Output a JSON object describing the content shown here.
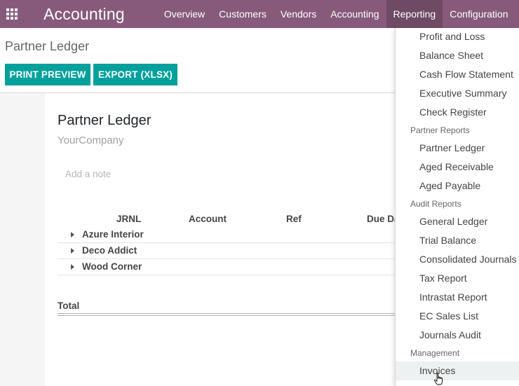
{
  "navbar": {
    "apps_icon": "grid-icon",
    "app_title": "Accounting",
    "menu": [
      "Overview",
      "Customers",
      "Vendors",
      "Accounting",
      "Reporting",
      "Configuration"
    ],
    "active_menu": "Reporting"
  },
  "control_panel": {
    "breadcrumb": "Partner Ledger",
    "print_preview": "PRINT PREVIEW",
    "export_xlsx": "EXPORT (XLSX)"
  },
  "report": {
    "title": "Partner Ledger",
    "company": "YourCompany",
    "note_placeholder": "Add a note",
    "columns": [
      "JRNL",
      "Account",
      "Ref",
      "Due Da"
    ],
    "rows": [
      "Azure Interior",
      "Deco Addict",
      "Wood Corner"
    ],
    "total_label": "Total"
  },
  "dropdown": {
    "top_items": [
      "Profit and Loss",
      "Balance Sheet",
      "Cash Flow Statement",
      "Executive Summary",
      "Check Register"
    ],
    "partner_header": "Partner Reports",
    "partner_items": [
      "Partner Ledger",
      "Aged Receivable",
      "Aged Payable"
    ],
    "audit_header": "Audit Reports",
    "audit_items": [
      "General Ledger",
      "Trial Balance",
      "Consolidated Journals",
      "Tax Report",
      "Intrastat Report",
      "EC Sales List",
      "Journals Audit"
    ],
    "management_header": "Management",
    "management_items": [
      "Invoices"
    ]
  },
  "colors": {
    "navbar": "#875a7b",
    "navbar_active": "#6f4a64",
    "button": "#00a09d"
  }
}
